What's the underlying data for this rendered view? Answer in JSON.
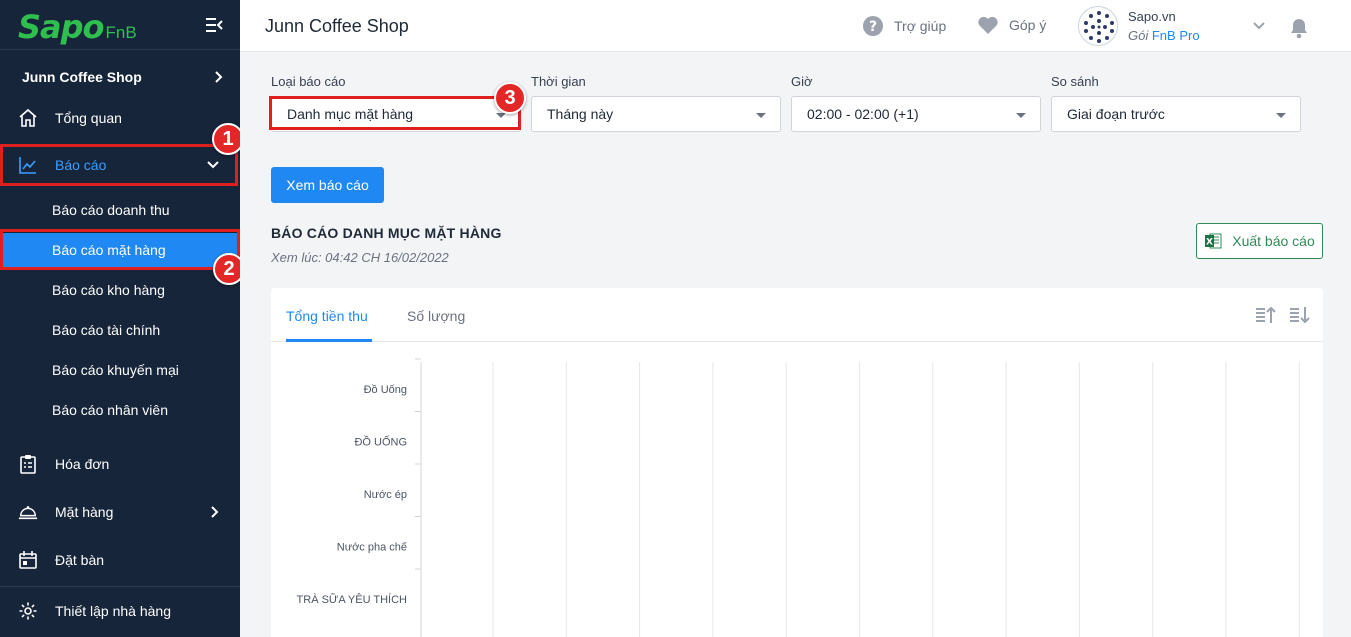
{
  "sidebar": {
    "logo_text": "Sapo",
    "logo_suffix": "FnB",
    "store_name": "Junn Coffee Shop",
    "items": [
      {
        "label": "Tổng quan"
      },
      {
        "label": "Báo cáo"
      },
      {
        "label": "Hóa đơn"
      },
      {
        "label": "Mặt hàng"
      },
      {
        "label": "Đặt bàn"
      },
      {
        "label": "Thiết lập nhà hàng"
      }
    ],
    "report_subitems": [
      {
        "label": "Báo cáo doanh thu"
      },
      {
        "label": "Báo cáo mặt hàng"
      },
      {
        "label": "Báo cáo kho hàng"
      },
      {
        "label": "Báo cáo tài chính"
      },
      {
        "label": "Báo cáo khuyến mại"
      },
      {
        "label": "Báo cáo nhân viên"
      }
    ]
  },
  "annotations": {
    "badge1": "1",
    "badge2": "2",
    "badge3": "3"
  },
  "header": {
    "title": "Junn Coffee Shop",
    "help_label": "Trợ giúp",
    "feedback_label": "Góp ý",
    "account_name": "Sapo.vn",
    "plan_prefix": "Gói",
    "plan_name": "FnB Pro"
  },
  "filters": {
    "report_type": {
      "label": "Loại báo cáo",
      "value": "Danh mục mặt hàng"
    },
    "time": {
      "label": "Thời gian",
      "value": "Tháng này"
    },
    "hour": {
      "label": "Giờ",
      "value": "02:00 - 02:00 (+1)"
    },
    "compare": {
      "label": "So sánh",
      "value": "Giai đoạn trước"
    }
  },
  "view_button": "Xem báo cáo",
  "report": {
    "title": "BÁO CÁO DANH MỤC MẶT HÀNG",
    "viewed_at": "Xem lúc: 04:42 CH 16/02/2022",
    "export_button": "Xuất báo cáo",
    "tabs": [
      "Tổng tiền thu",
      "Số lượng"
    ]
  },
  "colors": {
    "accent": "#1f88f2",
    "sidebar_bg": "#17253a",
    "annotation_red": "#e01f1f",
    "export_green": "#2e8b57"
  },
  "chart_data": {
    "type": "bar",
    "orientation": "horizontal",
    "categories": [
      "Đồ Uống",
      "ĐỒ UỐNG",
      "Nước ép",
      "Nước pha chế",
      "TRÀ SỮA YÊU THÍCH"
    ],
    "values": [],
    "grid": true
  }
}
